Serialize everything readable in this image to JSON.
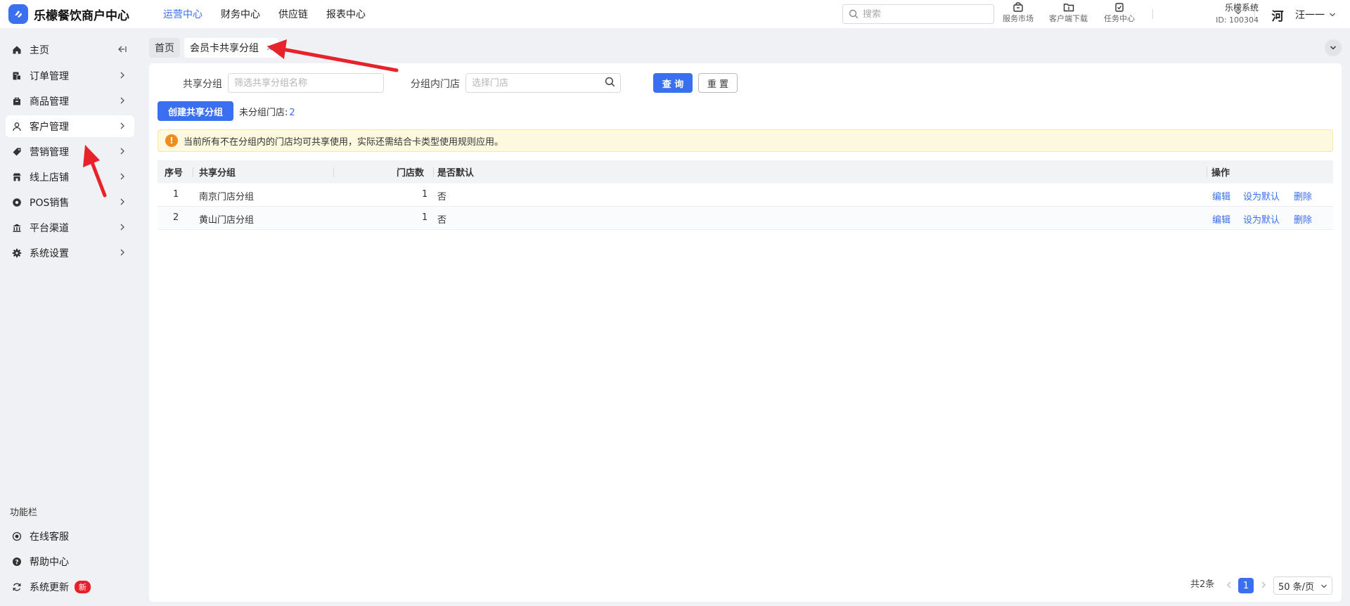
{
  "app": {
    "title": "乐檬餐饮商户中心"
  },
  "topnav": [
    "运营中心",
    "财务中心",
    "供应链",
    "报表中心"
  ],
  "search": {
    "placeholder": "搜索"
  },
  "tools": {
    "market": "服务市场",
    "download": "客户端下载",
    "tasks": "任务中心"
  },
  "org": {
    "name": "乐檬系统",
    "id": "ID: 100304"
  },
  "user": {
    "avatar_text": "河",
    "name": "汪一一"
  },
  "sidebar": {
    "items": [
      {
        "label": "主页",
        "icon": "home-icon"
      },
      {
        "label": "订单管理",
        "icon": "order-icon"
      },
      {
        "label": "商品管理",
        "icon": "goods-icon"
      },
      {
        "label": "客户管理",
        "icon": "user-icon"
      },
      {
        "label": "营销管理",
        "icon": "tag-icon"
      },
      {
        "label": "线上店铺",
        "icon": "store-icon"
      },
      {
        "label": "POS销售",
        "icon": "pos-icon"
      },
      {
        "label": "平台渠道",
        "icon": "bank-icon"
      },
      {
        "label": "系统设置",
        "icon": "gear-icon"
      }
    ],
    "section_title": "功能栏",
    "bottom_items": [
      {
        "label": "在线客服",
        "icon": "headset-icon"
      },
      {
        "label": "帮助中心",
        "icon": "help-icon"
      },
      {
        "label": "系统更新",
        "icon": "refresh-icon",
        "badge": "新"
      }
    ]
  },
  "tabs": [
    {
      "label": "首页"
    },
    {
      "label": "会员卡共享分组",
      "close": "×"
    }
  ],
  "filters": {
    "group_label": "共享分组",
    "group_placeholder": "筛选共享分组名称",
    "store_label": "分组内门店",
    "store_placeholder": "选择门店",
    "query": "查 询",
    "reset": "重 置"
  },
  "actions": {
    "create": "创建共享分组",
    "ungrouped_label": "未分组门店:",
    "ungrouped_count": "2"
  },
  "alert": {
    "text": "当前所有不在分组内的门店均可共享使用，实际还需结合卡类型使用规则应用。"
  },
  "table": {
    "headers": [
      "序号",
      "共享分组",
      "门店数",
      "是否默认",
      "操作"
    ],
    "rows": [
      {
        "index": "1",
        "group": "南京门店分组",
        "stores": "1",
        "is_default": "否"
      },
      {
        "index": "2",
        "group": "黄山门店分组",
        "stores": "1",
        "is_default": "否"
      }
    ],
    "row_actions": [
      "编辑",
      "设为默认",
      "删除"
    ]
  },
  "pagination": {
    "total": "共2条",
    "current": "1",
    "page_size": "50 条/页"
  },
  "colors": {
    "primary": "#3a6ff0",
    "alert_bg": "#fdf9e1",
    "alert_icon": "#f08c1e",
    "badge": "#e8202a",
    "annotation": "#e8222a"
  }
}
